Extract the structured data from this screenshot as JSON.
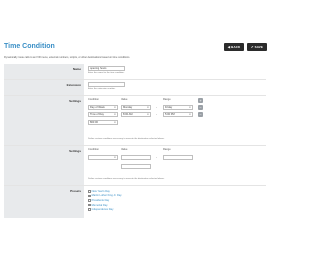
{
  "header": {
    "title": "Time Condition",
    "back_label": "BACK",
    "save_label": "SAVE",
    "description": "Dynamically route calls to an IVR menu, external numbers, scripts, or other destinations based on time conditions."
  },
  "name": {
    "label": "Name",
    "value": "opening hours",
    "help": "Enter the name for the time condition."
  },
  "extension": {
    "label": "Extension",
    "value": "",
    "help": "Enter the extension number."
  },
  "settings1": {
    "label": "Settings",
    "col_condition": "Condition",
    "col_value": "Value",
    "col_range": "Range",
    "rows": [
      {
        "condition": "Day of Week",
        "value": "Monday",
        "dash": "-",
        "range": "Friday"
      },
      {
        "condition": "Time of Day",
        "value": "8:00 AM",
        "dash": "-",
        "range": "5:00 PM"
      }
    ],
    "extra": "800 00",
    "help": "Define custom conditions necessary to execute the destination selected above."
  },
  "settings2": {
    "label": "Settings",
    "col_condition": "Condition",
    "col_value": "Value",
    "col_range": "Range",
    "dash": "-",
    "help": "Define custom conditions necessary to execute the destination selected above."
  },
  "presets": {
    "label": "Presets",
    "items": [
      "New Year's Day",
      "Martin Luther King Jr. Day",
      "Presidents Day",
      "Memorial Day",
      "Independence Day"
    ]
  },
  "icons": {
    "add": "plus-icon",
    "remove": "minus-icon",
    "back": "arrow-left-icon",
    "save": "check-icon"
  },
  "colors": {
    "accent": "#3a8fc6",
    "button": "#2b2b2b",
    "label_bg": "#e8eaec"
  }
}
